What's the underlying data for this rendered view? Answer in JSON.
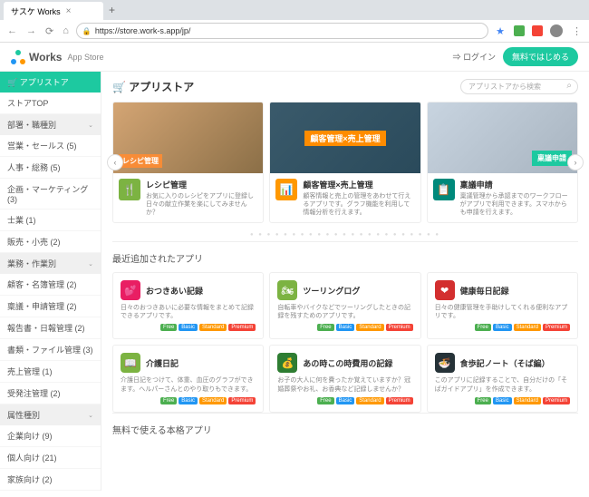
{
  "browser": {
    "tab_title": "サスケ Works",
    "url": "https://store.work-s.app/jp/"
  },
  "header": {
    "brand": "Works",
    "brand_sub": "App Store",
    "login": "⇒ ログイン",
    "start": "無料ではじめる"
  },
  "sidebar": {
    "head": "🛒 アプリストア",
    "top": "ストアTOP",
    "cat1": "部署・職種別",
    "items1": [
      "営業・セールス (5)",
      "人事・総務 (5)",
      "企画・マーケティング (3)",
      "士業 (1)",
      "販売・小売 (2)"
    ],
    "cat2": "業務・作業別",
    "items2": [
      "顧客・名簿管理 (2)",
      "稟議・申請管理 (2)",
      "報告書・日報管理 (2)",
      "書類・ファイル管理 (3)",
      "売上管理 (1)",
      "受発注管理 (2)"
    ],
    "cat3": "属性種別",
    "items3": [
      "企業向け (9)",
      "個人向け (21)",
      "家族向け (2)"
    ]
  },
  "main": {
    "title": "🛒 アプリストア",
    "search_placeholder": "アプリストアから検索"
  },
  "featured": [
    {
      "img_title": "レシピ管理",
      "icon": "🍴",
      "title": "レシピ管理",
      "desc": "お気に入りのレシピをアプリに登録し日々の献立作業を楽にしてみませんか？",
      "color": "ic-green",
      "imgcls": "recipe"
    },
    {
      "img_title": "顧客管理×売上管理",
      "icon": "📊",
      "title": "顧客管理×売上管理",
      "desc": "顧客情報と売上の管理をあわせて行えるアプリです。グラフ機能を利用して情報分析を行えます。",
      "color": "ic-orange",
      "imgcls": "crm"
    },
    {
      "img_title": "稟議申請",
      "icon": "📋",
      "title": "稟議申請",
      "desc": "稟議管理から承認までのワークフローがアプリで利用できます。スマホからも申請を行えます。",
      "color": "ic-teal",
      "imgcls": "approval"
    }
  ],
  "recent_title": "最近追加されたアプリ",
  "recent": [
    {
      "icon": "💕",
      "color": "g-pink",
      "title": "おつきあい記録",
      "desc": "日々のおつきあいに必要な情報をまとめて記録できるアプリです。"
    },
    {
      "icon": "🏍",
      "color": "g-green",
      "title": "ツーリングログ",
      "desc": "自転車やバイクなどでツーリングしたときの記録を残すためのアプリです。"
    },
    {
      "icon": "❤",
      "color": "g-red",
      "title": "健康毎日記録",
      "desc": "日々の健康管理を手助けしてくれる便利なアプリです。"
    },
    {
      "icon": "📖",
      "color": "g-green",
      "title": "介護日記",
      "desc": "介護日記をつけて、体重、血圧のグラフができます。ヘルパーさんとのやり取りもできます。"
    },
    {
      "icon": "💰",
      "color": "g-dgreen",
      "title": "あの時この時費用の記録",
      "desc": "お子の大人に何を費ったか覚えていますか？冠婚葬祭やお礼、お香典など記録しませんか？"
    },
    {
      "icon": "🍜",
      "color": "g-navy",
      "title": "食歩記ノート（そば編）",
      "desc": "このアプリに記録することで、自分だけの「そばガイドアプリ」を作成できます。"
    }
  ],
  "badges": {
    "free": "Free",
    "basic": "Basic",
    "standard": "Standard",
    "premium": "Premium"
  },
  "free_title": "無料で使える本格アプリ"
}
